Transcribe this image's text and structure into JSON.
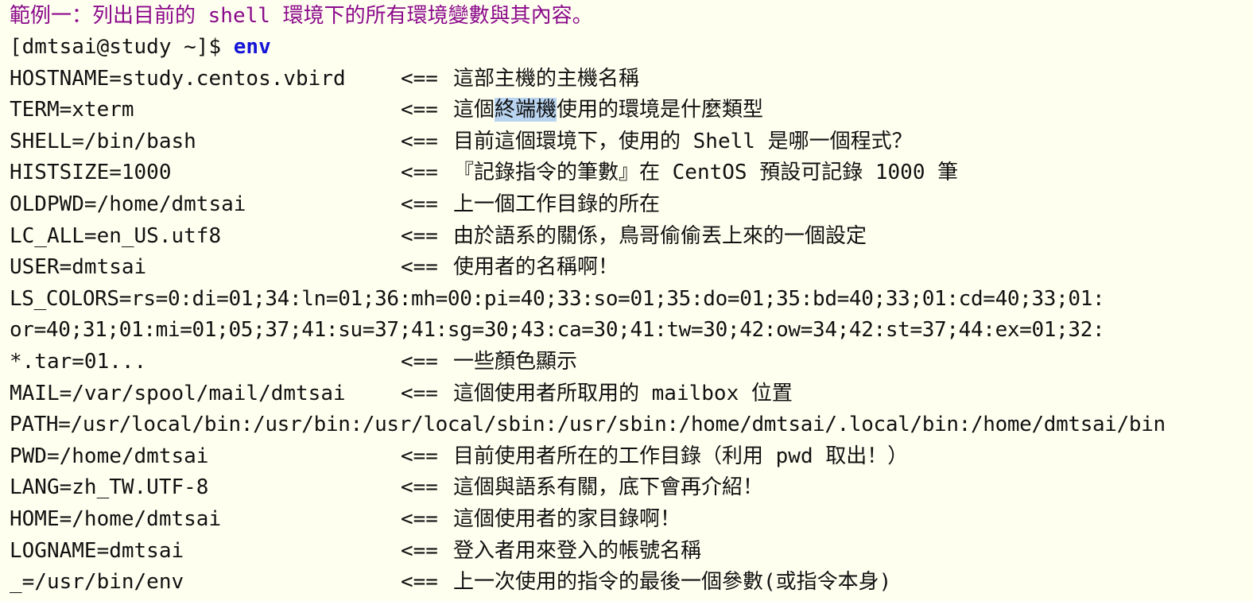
{
  "title": "範例一：列出目前的 shell 環境下的所有環境變數與其內容。",
  "prompt": "[dmtsai@study ~]$ ",
  "command": "env",
  "arrow": "<==",
  "highlight_color": "#b9d4f0",
  "command_color": "#1515d8",
  "title_color": "#8b0a8b",
  "lines": {
    "hostname": {
      "var": "HOSTNAME=study.centos.vbird",
      "comment": "這部主機的主機名稱"
    },
    "term": {
      "var": "TERM=xterm",
      "comment_pre": "這個",
      "comment_hl": "終端機",
      "comment_post": "使用的環境是什麼類型"
    },
    "shell": {
      "var": "SHELL=/bin/bash",
      "comment": "目前這個環境下，使用的 Shell 是哪一個程式？"
    },
    "histsize": {
      "var": "HISTSIZE=1000",
      "comment": "『記錄指令的筆數』在 CentOS 預設可記錄 1000 筆"
    },
    "oldpwd": {
      "var": "OLDPWD=/home/dmtsai",
      "comment": "上一個工作目錄的所在"
    },
    "lc_all": {
      "var": "LC_ALL=en_US.utf8",
      "comment": "由於語系的關係，鳥哥偷偷丟上來的一個設定"
    },
    "user": {
      "var": "USER=dmtsai",
      "comment": "使用者的名稱啊！"
    },
    "ls_colors_1": {
      "text": "LS_COLORS=rs=0:di=01;34:ln=01;36:mh=00:pi=40;33:so=01;35:do=01;35:bd=40;33;01:cd=40;33;01:"
    },
    "ls_colors_2": {
      "text": "or=40;31;01:mi=01;05;37;41:su=37;41:sg=30;43:ca=30;41:tw=30;42:ow=34;42:st=37;44:ex=01;32:"
    },
    "ls_colors_3": {
      "var": "*.tar=01...",
      "comment": "一些顏色顯示"
    },
    "mail": {
      "var": "MAIL=/var/spool/mail/dmtsai",
      "comment": "這個使用者所取用的 mailbox 位置"
    },
    "path": {
      "text": "PATH=/usr/local/bin:/usr/bin:/usr/local/sbin:/usr/sbin:/home/dmtsai/.local/bin:/home/dmtsai/bin"
    },
    "pwd": {
      "var": "PWD=/home/dmtsai",
      "comment": "目前使用者所在的工作目錄（利用 pwd 取出！）"
    },
    "lang": {
      "var": "LANG=zh_TW.UTF-8",
      "comment": "這個與語系有關，底下會再介紹！"
    },
    "home": {
      "var": "HOME=/home/dmtsai",
      "comment": "這個使用者的家目錄啊！"
    },
    "logname": {
      "var": "LOGNAME=dmtsai",
      "comment": "登入者用來登入的帳號名稱"
    },
    "underscore": {
      "var": "_=/usr/bin/env",
      "comment": "上一次使用的指令的最後一個參數(或指令本身)"
    }
  }
}
